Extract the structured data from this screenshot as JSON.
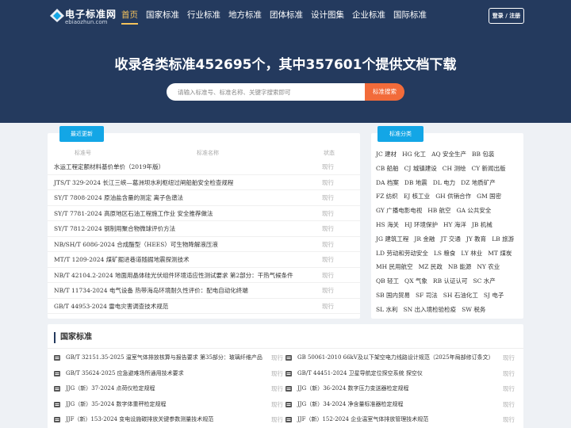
{
  "header": {
    "logo_title": "电子标准网",
    "logo_domain": "ebiaozhun.com",
    "nav": [
      {
        "label": "首页",
        "active": true
      },
      {
        "label": "国家标准",
        "active": false
      },
      {
        "label": "行业标准",
        "active": false
      },
      {
        "label": "地方标准",
        "active": false
      },
      {
        "label": "团体标准",
        "active": false
      },
      {
        "label": "设计图集",
        "active": false
      },
      {
        "label": "企业标准",
        "active": false
      },
      {
        "label": "国际标准",
        "active": false
      }
    ],
    "login_label": "登录 / 注册"
  },
  "hero": {
    "title": "收录各类标准452695个，其中357601个提供文档下载",
    "search_placeholder": "请输入标准号、标准名称、关键字搜索即可",
    "search_button": "标准搜索"
  },
  "latest": {
    "tab_label": "最近更新",
    "columns": [
      "标准号",
      "标准名称",
      "状态"
    ],
    "rows": [
      {
        "title": "水运工程定额材料基价单价（2019年版）",
        "status": "现行"
      },
      {
        "title": "JTS/T 329-2024 长江三峡—葛洲坝水利枢纽过闸船舶安全检查规程",
        "status": "现行"
      },
      {
        "title": "SY/T 7808-2024 原油盐含量的测定 离子色谱法",
        "status": "现行"
      },
      {
        "title": "SY/T 7781-2024 高原地区石油工程施工作业 安全推荐做法",
        "status": "现行"
      },
      {
        "title": "SY/T 7812-2024 钢制用聚合物微球评价方法",
        "status": "现行"
      },
      {
        "title": "NB/SH/T 6086-2024 合成酯型（HEES）可生物降解液压液",
        "status": "现行"
      },
      {
        "title": "MT/T 1209-2024 煤矿掘进巷道随掘地震探测技术",
        "status": "现行"
      },
      {
        "title": "NB/T 42104.2-2024 地面用晶体硅光伏组件环境适应性测试要求 第2部分：干热气候条件",
        "status": "现行"
      },
      {
        "title": "NB/T 11734-2024 电气设备 热带海岛环境耐久性评价：配电自动化终端",
        "status": "现行"
      },
      {
        "title": "GB/T 44953-2024 雷电灾害调查技术规范",
        "status": "现行"
      }
    ]
  },
  "categories": {
    "tab_label": "标准分类",
    "lines": [
      [
        "JC 建材",
        "HG 化工",
        "AQ 安全生产",
        "BB 包装"
      ],
      [
        "CB 船舶",
        "CJ 城镇建设",
        "CH 测绘",
        "CY 新闻出版"
      ],
      [
        "DA 档案",
        "DB 地震",
        "DL 电力",
        "DZ 地质矿产"
      ],
      [
        "FZ 纺织",
        "EJ 核工业",
        "GH 供销合作",
        "GM 国密"
      ],
      [
        "GY 广播电影电视",
        "HB 航空",
        "GA 公共安全"
      ],
      [
        "HS 海关",
        "HJ 环境保护",
        "HY 海洋",
        "JB 机械"
      ],
      [
        "JG 建筑工程",
        "JR 金融",
        "JT 交通",
        "JY 教育",
        "LB 旅游"
      ],
      [
        "LD 劳动和劳动安全",
        "LS 粮食",
        "LY 林业",
        "MT 煤炭"
      ],
      [
        "MH 民用航空",
        "MZ 民政",
        "NB 能源",
        "NY 农业"
      ],
      [
        "QB 轻工",
        "QX 气象",
        "RB 认证认可",
        "SC 水产"
      ],
      [
        "SB 国内贸易",
        "SF 司法",
        "SH 石油化工",
        "SJ 电子"
      ],
      [
        "SL 水利",
        "SN 出入境检验检疫",
        "SW 税务"
      ]
    ]
  },
  "national": {
    "title": "国家标准",
    "left": [
      {
        "title": "GB/T 32151.35-2025 温室气体排放核算与报告要求 第35部分：玻璃纤维产品",
        "status": "现行"
      },
      {
        "title": "GB/T 35624-2025 应急避难场所通用技术要求",
        "status": "现行"
      },
      {
        "title": "JJG（新）37-2024 点荷仪检定规程",
        "status": "现行"
      },
      {
        "title": "JJG（新）35-2024 数字体重秤检定规程",
        "status": "现行"
      },
      {
        "title": "JJF（新）153-2024 变电设施碳排放关键参数测量技术规范",
        "status": "现行"
      }
    ],
    "right": [
      {
        "title": "GB 50061-2010 66kV及以下架空电力线路设计规范（2025年局部修订条文）",
        "status": "现行"
      },
      {
        "title": "GB/T 44451-2024 卫星导航定位探空系统 探空仪",
        "status": "现行"
      },
      {
        "title": "JJG（新）36-2024 数字压力变送器检定规程",
        "status": "现行"
      },
      {
        "title": "JJG（新）34-2024 净含量标准器检定规程",
        "status": "现行"
      },
      {
        "title": "JJF（新）152-2024 企业温室气体排放管理技术规范",
        "status": "现行"
      }
    ]
  },
  "colors": {
    "header_bg": "#243a5e",
    "accent_blue": "#13a6e6",
    "search_button": "#f26b3a",
    "nav_active": "#f6c35b"
  }
}
